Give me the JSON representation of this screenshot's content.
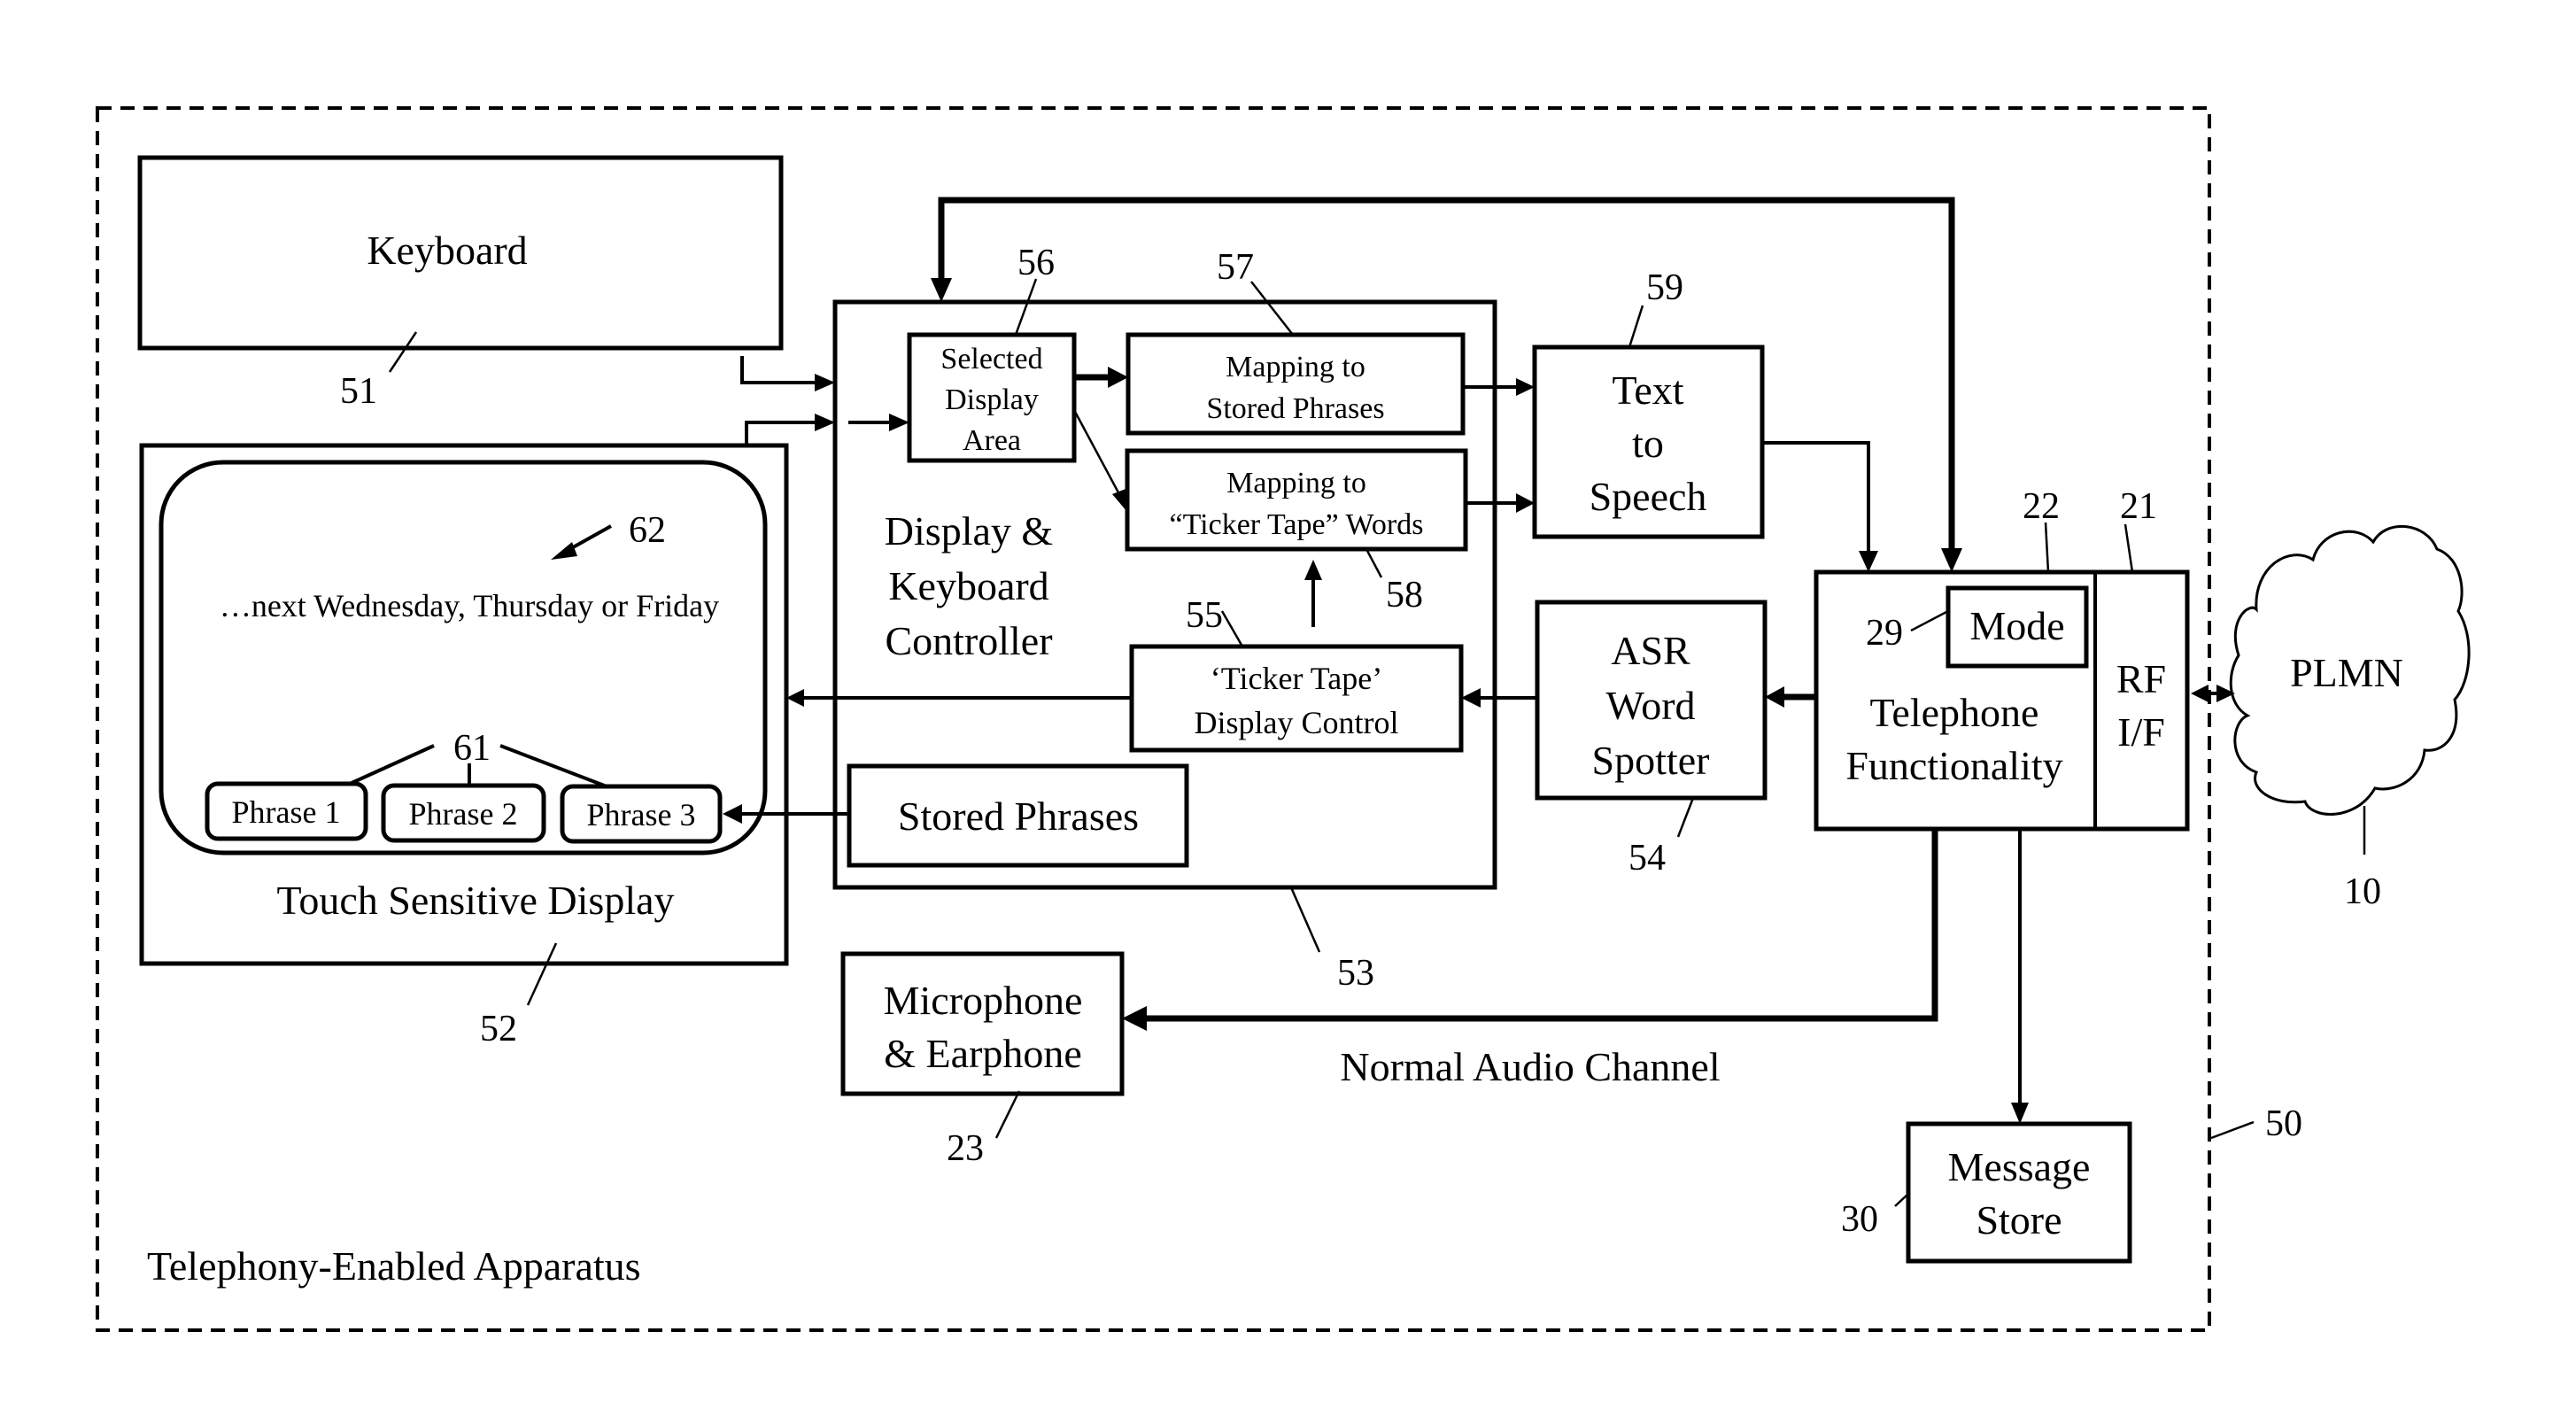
{
  "diagram": {
    "apparatus_label": "Telephony-Enabled Apparatus",
    "apparatus_ref": "50",
    "blocks": {
      "keyboard": {
        "label": "Keyboard",
        "ref": "51"
      },
      "touch_display": {
        "label": "Touch Sensitive Display",
        "ref": "52",
        "screen_text": "…next Wednesday, Thursday or Friday",
        "screen_ref": "62",
        "phrase_ref": "61",
        "phrases": [
          "Phrase 1",
          "Phrase 2",
          "Phrase 3"
        ]
      },
      "controller": {
        "label_lines": [
          "Display &",
          "Keyboard",
          "Controller"
        ],
        "ref": "53"
      },
      "selected_display_area": {
        "label_lines": [
          "Selected",
          "Display",
          "Area"
        ],
        "ref": "56"
      },
      "mapping_stored": {
        "label_lines": [
          "Mapping to",
          "Stored Phrases"
        ],
        "ref": "57"
      },
      "mapping_ticker": {
        "label_lines": [
          "Mapping to",
          "“Ticker Tape” Words"
        ],
        "ref": "58"
      },
      "ticker_control": {
        "label_lines": [
          "‘Ticker Tape’",
          "Display  Control"
        ],
        "ref": "55"
      },
      "stored_phrases": {
        "label": "Stored Phrases"
      },
      "text_to_speech": {
        "label_lines": [
          "Text",
          "to",
          "Speech"
        ],
        "ref": "59"
      },
      "asr": {
        "label_lines": [
          "ASR",
          "Word",
          "Spotter"
        ],
        "ref": "54"
      },
      "telephone": {
        "label_lines": [
          "Telephone",
          "Functionality"
        ],
        "ref": "22"
      },
      "mode": {
        "label": "Mode",
        "ref": "29"
      },
      "rf_if": {
        "label_lines": [
          "RF",
          "I/F"
        ],
        "ref": "21"
      },
      "plmn": {
        "label": "PLMN",
        "ref": "10"
      },
      "mic_earphone": {
        "label_lines": [
          "Microphone",
          "& Earphone"
        ],
        "ref": "23"
      },
      "message_store": {
        "label_lines": [
          "Message",
          "Store"
        ],
        "ref": "30"
      }
    },
    "connections": {
      "audio_channel_label": "Normal Audio Channel"
    }
  }
}
